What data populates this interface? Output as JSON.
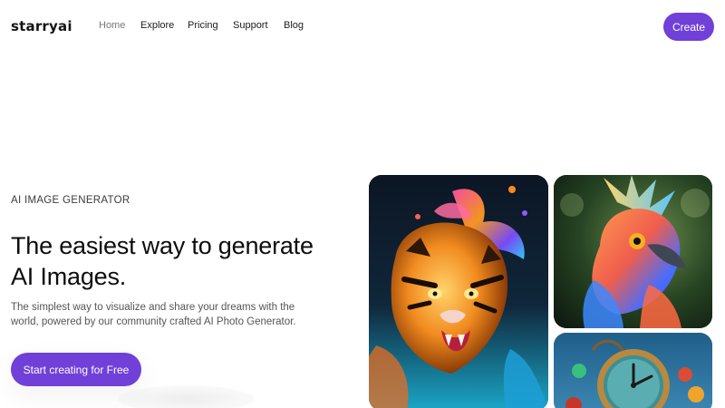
{
  "header": {
    "logo": "starryai",
    "nav": [
      "Home",
      "Explore",
      "Pricing",
      "Support",
      "Blog"
    ],
    "create_label": "Create"
  },
  "hero": {
    "eyebrow": "AI IMAGE GENERATOR",
    "headline": "The easiest way to generate AI Images.",
    "subtext": "The simplest way to visualize and share your dreams with the world, powered by our community crafted AI Photo Generator.",
    "cta_label": "Start creating for Free"
  },
  "gallery": {
    "images": [
      "tiger-art-image",
      "bird-art-image",
      "clock-art-image"
    ]
  },
  "colors": {
    "accent": "#7040d8",
    "text_primary": "#0d0d0d",
    "text_muted": "#555555",
    "nav_active": "#777777"
  }
}
